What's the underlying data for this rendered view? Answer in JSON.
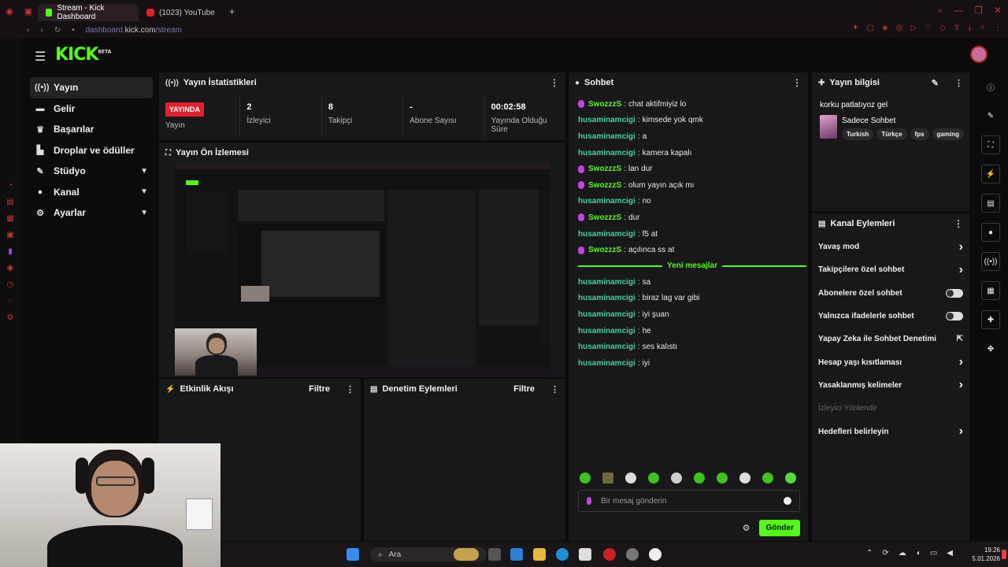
{
  "browser": {
    "tabs": [
      {
        "label": "Stream - Kick Dashboard"
      },
      {
        "label": "(1023) YouTube"
      }
    ],
    "new_tab_label": "+",
    "url_prefix": "dashboard.",
    "url_domain": "kick.com",
    "url_path": "/stream"
  },
  "app": {
    "logo_text": "KICK",
    "logo_badge": "BETA",
    "accent": "#53fc18",
    "live_red": "#e4202b"
  },
  "nav": {
    "items": [
      {
        "label": "Yayın",
        "icon": "broadcast-icon"
      },
      {
        "label": "Gelir",
        "icon": "revenue-icon"
      },
      {
        "label": "Başarılar",
        "icon": "trophy-icon"
      },
      {
        "label": "Droplar ve ödüller",
        "icon": "drops-icon"
      },
      {
        "label": "Stüdyo",
        "icon": "studio-icon"
      },
      {
        "label": "Kanal",
        "icon": "user-icon"
      },
      {
        "label": "Ayarlar",
        "icon": "gear-icon"
      }
    ]
  },
  "stats_panel": {
    "title": "Yayın İstatistikleri",
    "live_badge": "YAYINDA",
    "stats": [
      {
        "value": "",
        "label": "Yayın"
      },
      {
        "value": "2",
        "label": "İzleyici"
      },
      {
        "value": "8",
        "label": "Takipçi"
      },
      {
        "value": "-",
        "label": "Abone Sayısı"
      },
      {
        "value": "00:02:58",
        "label": "Yayında Olduğu Süre"
      }
    ]
  },
  "preview_panel": {
    "title": "Yayın Ön İzlemesi"
  },
  "activity_panel": {
    "title": "Etkinlik Akışı",
    "filter": "Filtre"
  },
  "moderation_panel": {
    "title": "Denetim Eylemleri",
    "filter": "Filtre"
  },
  "chat": {
    "title": "Sohbet",
    "messages_before": [
      {
        "user": "SwozzzS",
        "text": "chat aktifmiyiz lo",
        "mic": true
      },
      {
        "user": "husaminamcigi",
        "text": "kimsede yok qmk",
        "mic": false
      },
      {
        "user": "husaminamcigi",
        "text": "a",
        "mic": false
      },
      {
        "user": "husaminamcigi",
        "text": "kamera kapalı",
        "mic": false
      },
      {
        "user": "SwozzzS",
        "text": "lan dur",
        "mic": true
      },
      {
        "user": "SwozzzS",
        "text": "olum yayın açık mı",
        "mic": true
      },
      {
        "user": "husaminamcigi",
        "text": "no",
        "mic": false
      },
      {
        "user": "SwozzzS",
        "text": "dur",
        "mic": true
      },
      {
        "user": "husaminamcigi",
        "text": "f5 at",
        "mic": false
      },
      {
        "user": "SwozzzS",
        "text": "açılınca ss at",
        "mic": true
      }
    ],
    "new_messages_label": "Yeni mesajlar",
    "messages_after": [
      {
        "user": "husaminamcigi",
        "text": "sa"
      },
      {
        "user": "husaminamcigi",
        "text": "biraz lag var gibi"
      },
      {
        "user": "husaminamcigi",
        "text": "iyi şuan"
      },
      {
        "user": "husaminamcigi",
        "text": "he"
      },
      {
        "user": "husaminamcigi",
        "text": "ses kalıstı"
      },
      {
        "user": "husaminamcigi",
        "text": "iyi"
      }
    ],
    "input_placeholder": "Bir mesaj gönderin",
    "send_label": "Gönder"
  },
  "stream_info": {
    "title": "Yayın bilgisi",
    "stream_title": "korku patlatıyoz gel",
    "category": "Sadece Sohbet",
    "tags": [
      "Turkish",
      "Türkçe",
      "fps",
      "gaming"
    ]
  },
  "channel_actions": {
    "title": "Kanal Eylemleri",
    "items": [
      {
        "label": "Yavaş mod",
        "control": "chevron"
      },
      {
        "label": "Takipçilere özel sohbet",
        "control": "chevron"
      },
      {
        "label": "Abonelere özel sohbet",
        "control": "toggle"
      },
      {
        "label": "Yalnızca ifadelerle sohbet",
        "control": "toggle"
      },
      {
        "label": "Yapay Zeka ile Sohbet Denetimi",
        "control": "external"
      },
      {
        "label": "Hesap yaşı kısıtlaması",
        "control": "chevron"
      },
      {
        "label": "Yasaklanmış kelimeler",
        "control": "chevron"
      },
      {
        "label": "İzleyici Yönlendir",
        "control": "disabled"
      },
      {
        "label": "Hedefleri belirleyin",
        "control": "chevron"
      }
    ]
  },
  "taskbar": {
    "search_label": "Ara",
    "time": "19:26",
    "date": "5.01.2026"
  }
}
